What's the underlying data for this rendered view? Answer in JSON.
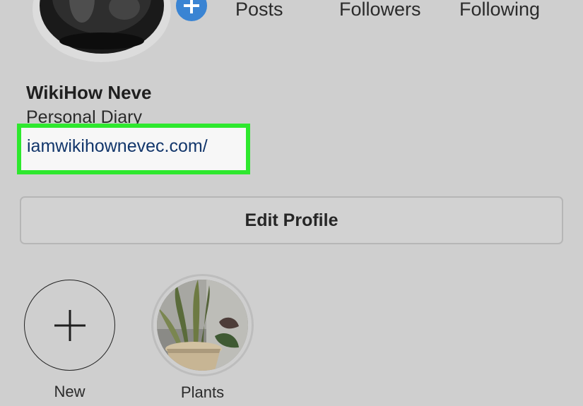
{
  "stats": {
    "posts_label": "Posts",
    "followers_label": "Followers",
    "following_label": "Following"
  },
  "profile": {
    "display_name": "WikiHow Neve",
    "bio": "Personal Diary",
    "website": "iamwikihownevec.com/"
  },
  "actions": {
    "edit_profile_label": "Edit Profile"
  },
  "highlights": [
    {
      "label": "New",
      "icon": "plus-icon"
    },
    {
      "label": "Plants",
      "icon": "plant-thumbnail"
    }
  ],
  "colors": {
    "background": "#cfcfcf",
    "highlight_box": "#2ee82e",
    "link": "#12366b",
    "badge": "#3a84d3"
  }
}
